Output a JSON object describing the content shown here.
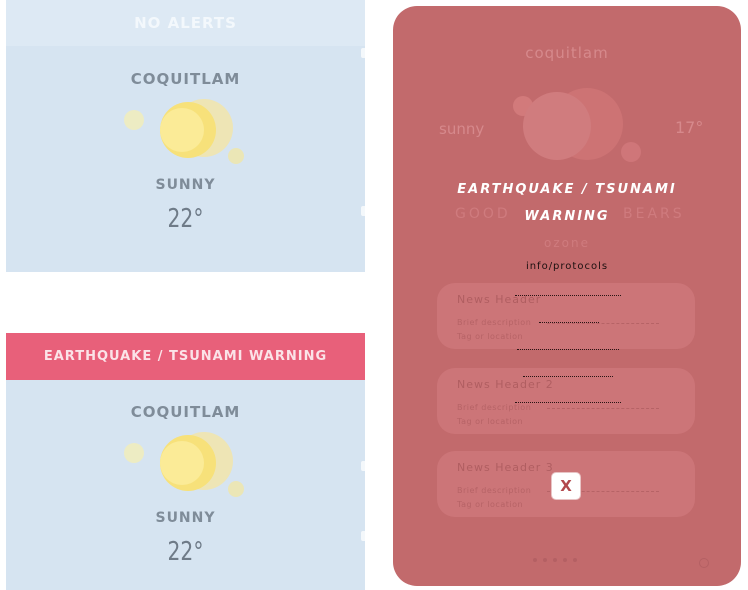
{
  "card_top": {
    "banner": "NO ALERTS",
    "city": "COQUITLAM",
    "condition": "SUNNY",
    "temperature": "22°",
    "weather_icon": "sun-icon"
  },
  "card_bottom": {
    "banner": "EARTHQUAKE / TSUNAMI WARNING",
    "city": "COQUITLAM",
    "condition": "SUNNY",
    "temperature": "22°",
    "weather_icon": "sun-icon"
  },
  "phone": {
    "city": "coquitlam",
    "condition": "sunny",
    "temperature": "17°",
    "background_labels": {
      "left": "GOOD",
      "right": "BEARS",
      "sub": "ozone"
    },
    "warning": {
      "title_line1": "EARTHQUAKE / TSUNAMI",
      "title_line2": "WARNING",
      "link": "info/protocols",
      "close_label": "X"
    },
    "news": [
      {
        "header": "News Header",
        "desc1": "Brief description",
        "desc2": "Tag or location"
      },
      {
        "header": "News Header 2",
        "desc1": "Brief description",
        "desc2": "Tag or location"
      },
      {
        "header": "News Header 3",
        "desc1": "Brief description",
        "desc2": "Tag or location"
      }
    ]
  },
  "colors": {
    "card_bg": "#d6e4f1",
    "alert_banner": "#e8607a",
    "phone_overlay": "#c26a6c",
    "sun_core": "#f6e58a"
  }
}
